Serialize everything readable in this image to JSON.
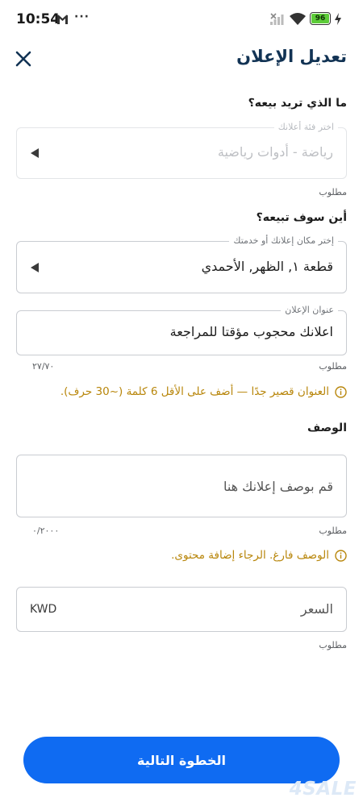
{
  "status_bar": {
    "time": "10:54",
    "dots": "···",
    "battery": "96"
  },
  "header": {
    "title": "تعديل الإعلان"
  },
  "category_section": {
    "label": "ما الذي تريد بيعه؟",
    "field_legend": "اختر فئة أعلانك",
    "field_value": "رياضة - أدوات رياضية",
    "required": "مطلوب"
  },
  "location_section": {
    "label": "أين سوف تبيعه؟",
    "field_legend": "إختر مكان إعلانك أو خدمتك",
    "field_value": "قطعة ١, الظهر, الأحمدي"
  },
  "title_field": {
    "legend": "عنوان الإعلان",
    "value": "اعلانك محجوب مؤقتا للمراجعة",
    "required": "مطلوب",
    "counter": "٢٧/٧٠",
    "warning": "العنوان قصير جدًا — أضف على الأقل 6 كلمة (~30 حرف)."
  },
  "description": {
    "label": "الوصف",
    "placeholder": "قم بوصف إعلانك هنا",
    "required": "مطلوب",
    "counter": "٠/٢٠٠٠",
    "warning": "الوصف فارغ. الرجاء إضافة محتوى."
  },
  "price": {
    "placeholder": "السعر",
    "currency": "KWD",
    "required": "مطلوب"
  },
  "actions": {
    "next_label": "الخطوة التالية"
  },
  "brand": {
    "watermark": "4SALE"
  },
  "colors": {
    "accent": "#0f6bf2",
    "title": "#123354",
    "warning": "#b8860b",
    "battery": "#5dcc39"
  }
}
